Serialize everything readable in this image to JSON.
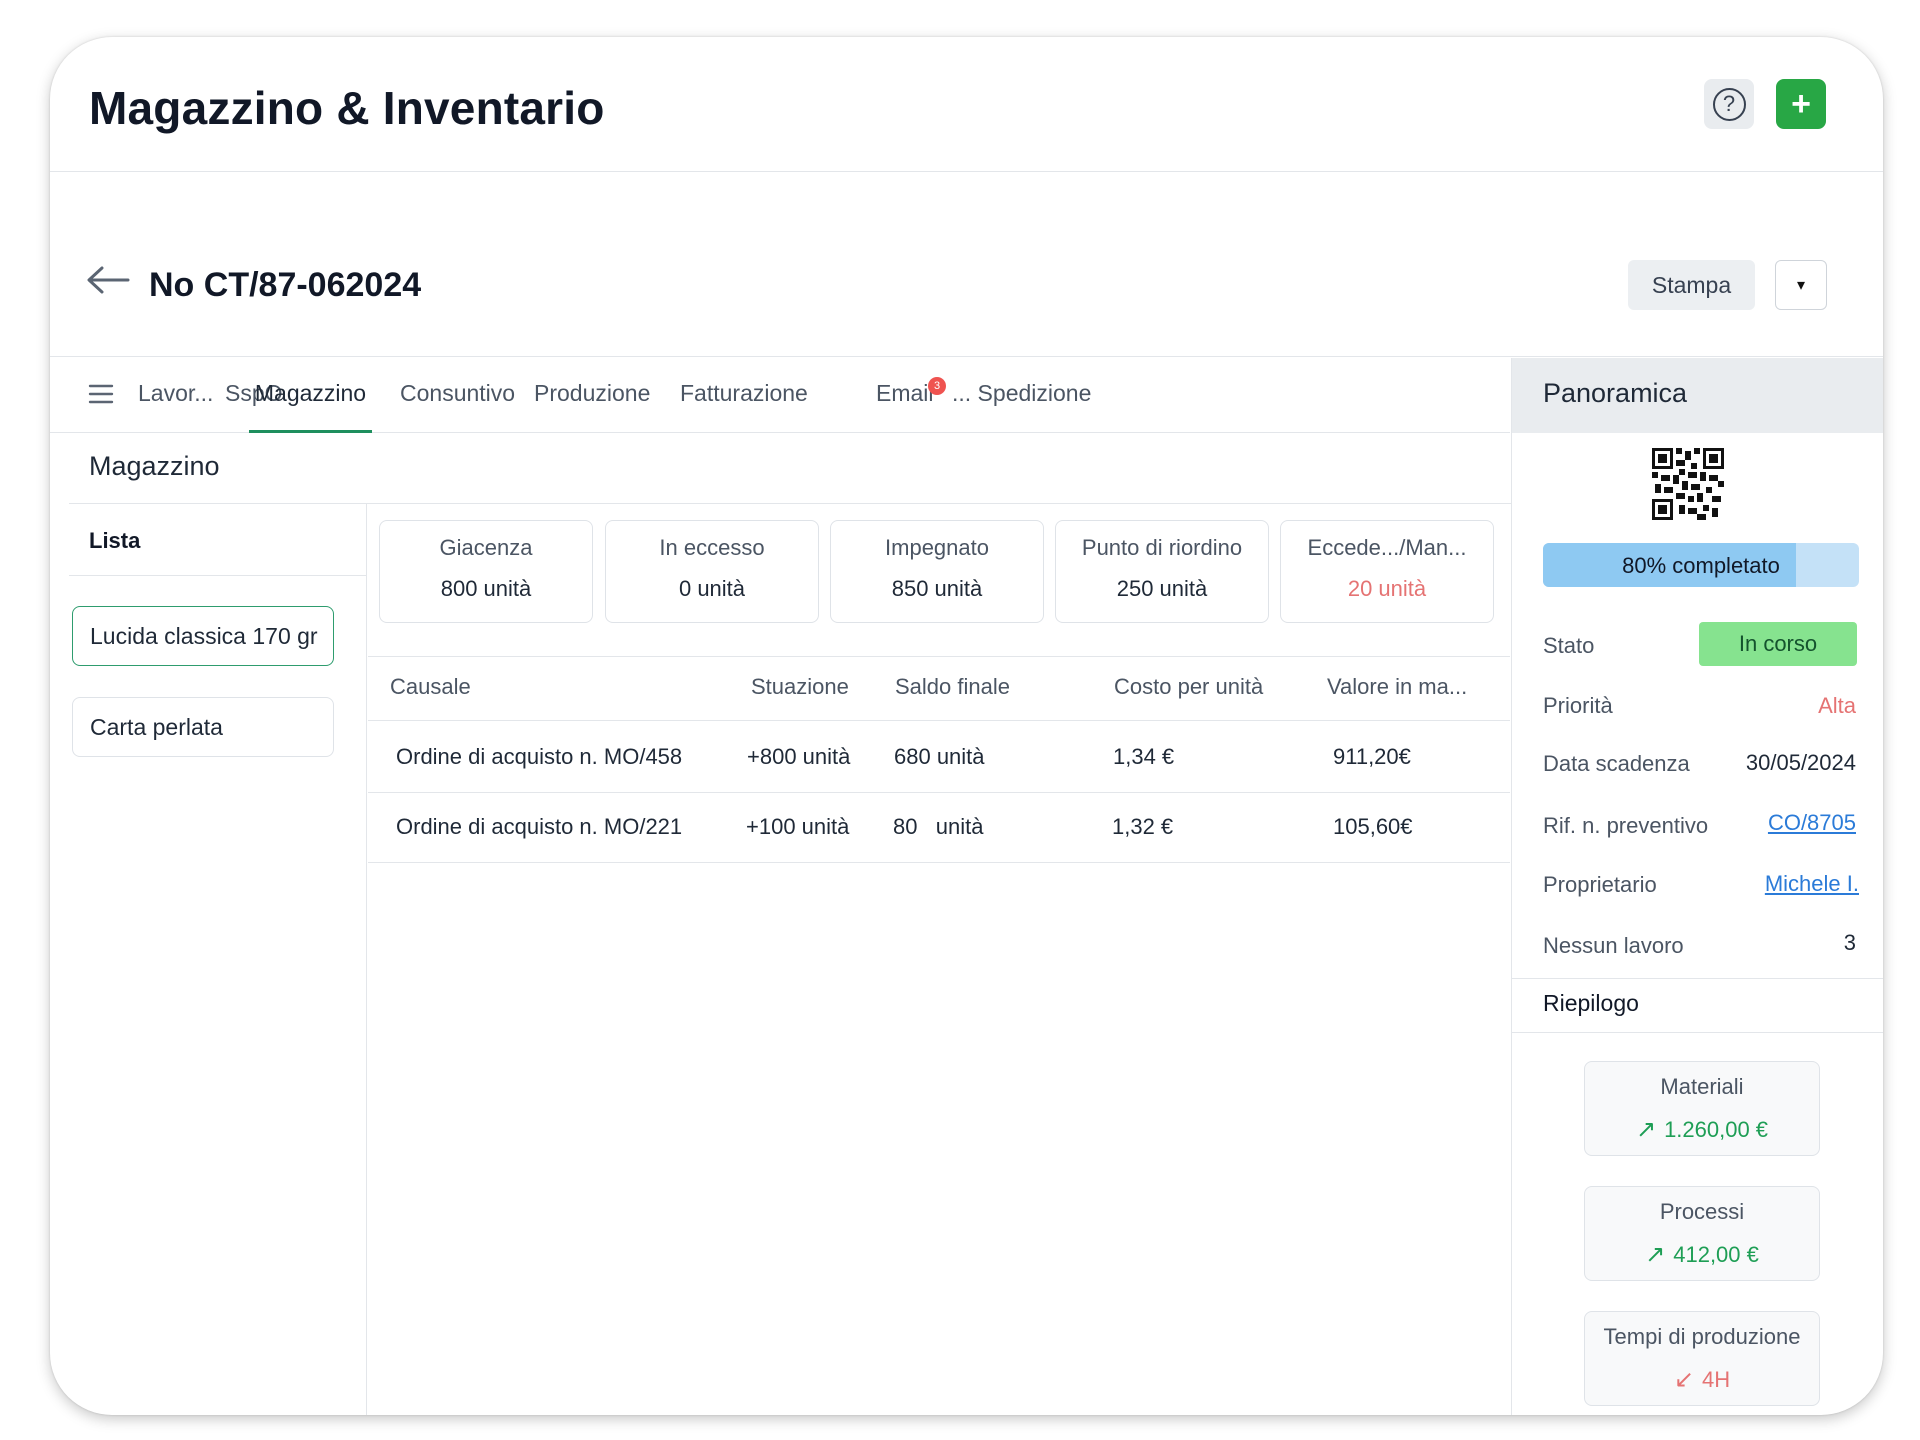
{
  "app": {
    "title": "Magazzino & Inventario"
  },
  "header_actions": {
    "help_icon": "question-circle-icon",
    "add_label": "+"
  },
  "document": {
    "title": "No CT/87-062024",
    "print_label": "Stampa",
    "dropdown_icon": "▾"
  },
  "tabs": [
    {
      "label": "Lavor...",
      "active": false
    },
    {
      "label": "SspO",
      "active": false
    },
    {
      "label": "Magazzino",
      "active": true
    },
    {
      "label": "Consuntivo",
      "active": false
    },
    {
      "label": "Produzione",
      "active": false
    },
    {
      "label": "Fatturazione",
      "active": false
    },
    {
      "label": "Email",
      "active": false,
      "badge": "3"
    },
    {
      "label": "... Spedizione",
      "active": false
    }
  ],
  "section": {
    "title": "Magazzino"
  },
  "list": {
    "header": "Lista",
    "items": [
      {
        "label": "Lucida classica 170 gr",
        "selected": true
      },
      {
        "label": "Carta perlata",
        "selected": false
      }
    ]
  },
  "stats": [
    {
      "label": "Giacenza",
      "value": "800 unità"
    },
    {
      "label": "In eccesso",
      "value": "0 unità"
    },
    {
      "label": "Impegnato",
      "value": "850 unità"
    },
    {
      "label": "Punto di riordino",
      "value": "250 unità"
    },
    {
      "label": "Eccede.../Man...",
      "value": "20 unità",
      "color": "#e57373"
    }
  ],
  "table": {
    "columns": [
      "Causale",
      "Stuazione",
      "Saldo finale",
      "Costo per unità",
      "Valore in ma..."
    ],
    "rows": [
      [
        "Ordine di acquisto n.  MO/458",
        "+800 unità",
        "680 unità",
        "1,34 €",
        "911,20€"
      ],
      [
        "Ordine di acquisto n.  MO/221",
        "+100 unità",
        "80   unità",
        "1,32 €",
        "105,60€"
      ]
    ]
  },
  "overview": {
    "title": "Panoramica",
    "qr_icon": "qr-code-icon",
    "progress": {
      "value": 0.8,
      "label": "80% completato"
    },
    "fields": [
      {
        "label": "Stato",
        "value": "In corso",
        "type": "badge",
        "color": "#86e38f"
      },
      {
        "label": "Priorità",
        "value": "Alta",
        "type": "red",
        "color": "#e57373"
      },
      {
        "label": "Data scadenza",
        "value": "30/05/2024",
        "type": "text"
      },
      {
        "label": "Rif. n. preventivo",
        "value": "CO/8705",
        "type": "link"
      },
      {
        "label": "Proprietario",
        "value": "Michele I.",
        "type": "link"
      },
      {
        "label": "Nessun lavoro",
        "value": "3",
        "type": "text"
      }
    ],
    "summary_title": "Riepilogo",
    "summary": [
      {
        "label": "Materiali",
        "value": "1.260,00 €",
        "trend": "up",
        "color": "#1e9e55",
        "icon": "arrow-up-right-icon"
      },
      {
        "label": "Processi",
        "value": "412,00 €",
        "trend": "up",
        "color": "#1e9e55",
        "icon": "arrow-up-right-icon"
      },
      {
        "label": "Tempi di produzione",
        "value": "4H",
        "trend": "down",
        "color": "#e57373",
        "icon": "arrow-down-left-icon"
      }
    ]
  }
}
